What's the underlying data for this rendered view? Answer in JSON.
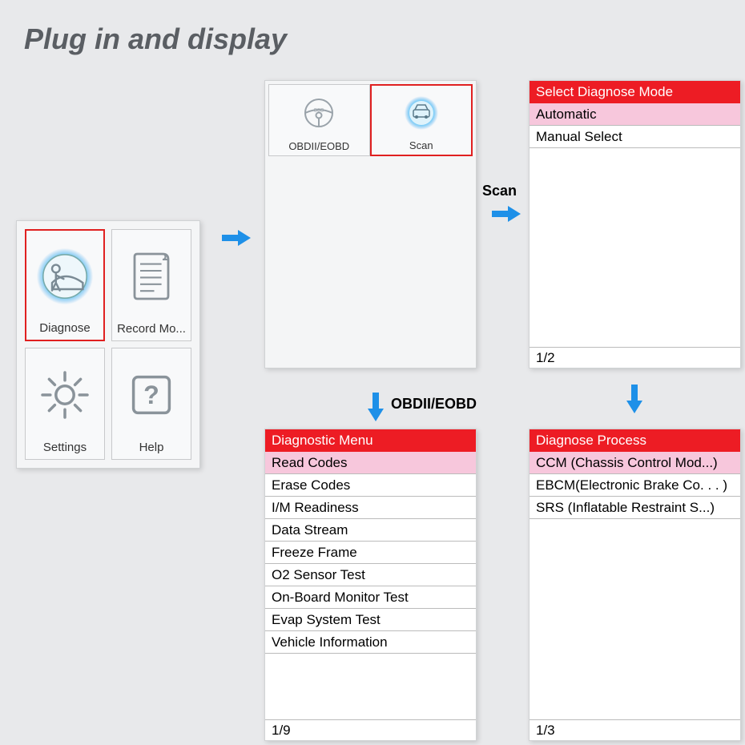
{
  "title": "Plug in and display",
  "home": {
    "items": [
      {
        "label": "Diagnose",
        "icon": "diagnose-icon",
        "selected": true
      },
      {
        "label": "Record Mo...",
        "icon": "record-icon",
        "selected": false
      },
      {
        "label": "Settings",
        "icon": "gear-icon",
        "selected": false
      },
      {
        "label": "Help",
        "icon": "help-icon",
        "selected": false
      }
    ]
  },
  "top": {
    "items": [
      {
        "label": "OBDII/EOBD",
        "icon": "steering-wheel-icon",
        "selected": false
      },
      {
        "label": "Scan",
        "icon": "car-scan-icon",
        "selected": true
      }
    ]
  },
  "arrow_labels": {
    "scan": "Scan",
    "obd": "OBDII/EOBD"
  },
  "mode_panel": {
    "header": "Select Diagnose Mode",
    "highlight": "Automatic",
    "items": [
      "Manual Select"
    ],
    "footer": "1/2"
  },
  "diag_panel": {
    "header": "Diagnostic Menu",
    "highlight": "Read Codes",
    "items": [
      "Erase Codes",
      "I/M Readiness",
      "Data Stream",
      "Freeze Frame",
      "O2 Sensor Test",
      "On-Board Monitor Test",
      "Evap System Test",
      "Vehicle Information"
    ],
    "footer": "1/9"
  },
  "proc_panel": {
    "header": "Diagnose Process",
    "highlight": "CCM (Chassis Control Mod...)",
    "items": [
      "EBCM(Electronic Brake Co. . . )",
      "SRS (Inflatable Restraint S...)"
    ],
    "footer": "1/3"
  },
  "colors": {
    "accent_red": "#ed1c24",
    "highlight_pink": "#f7c7dc",
    "arrow_blue": "#1e90e8",
    "glow_cyan": "#36c6ff"
  }
}
